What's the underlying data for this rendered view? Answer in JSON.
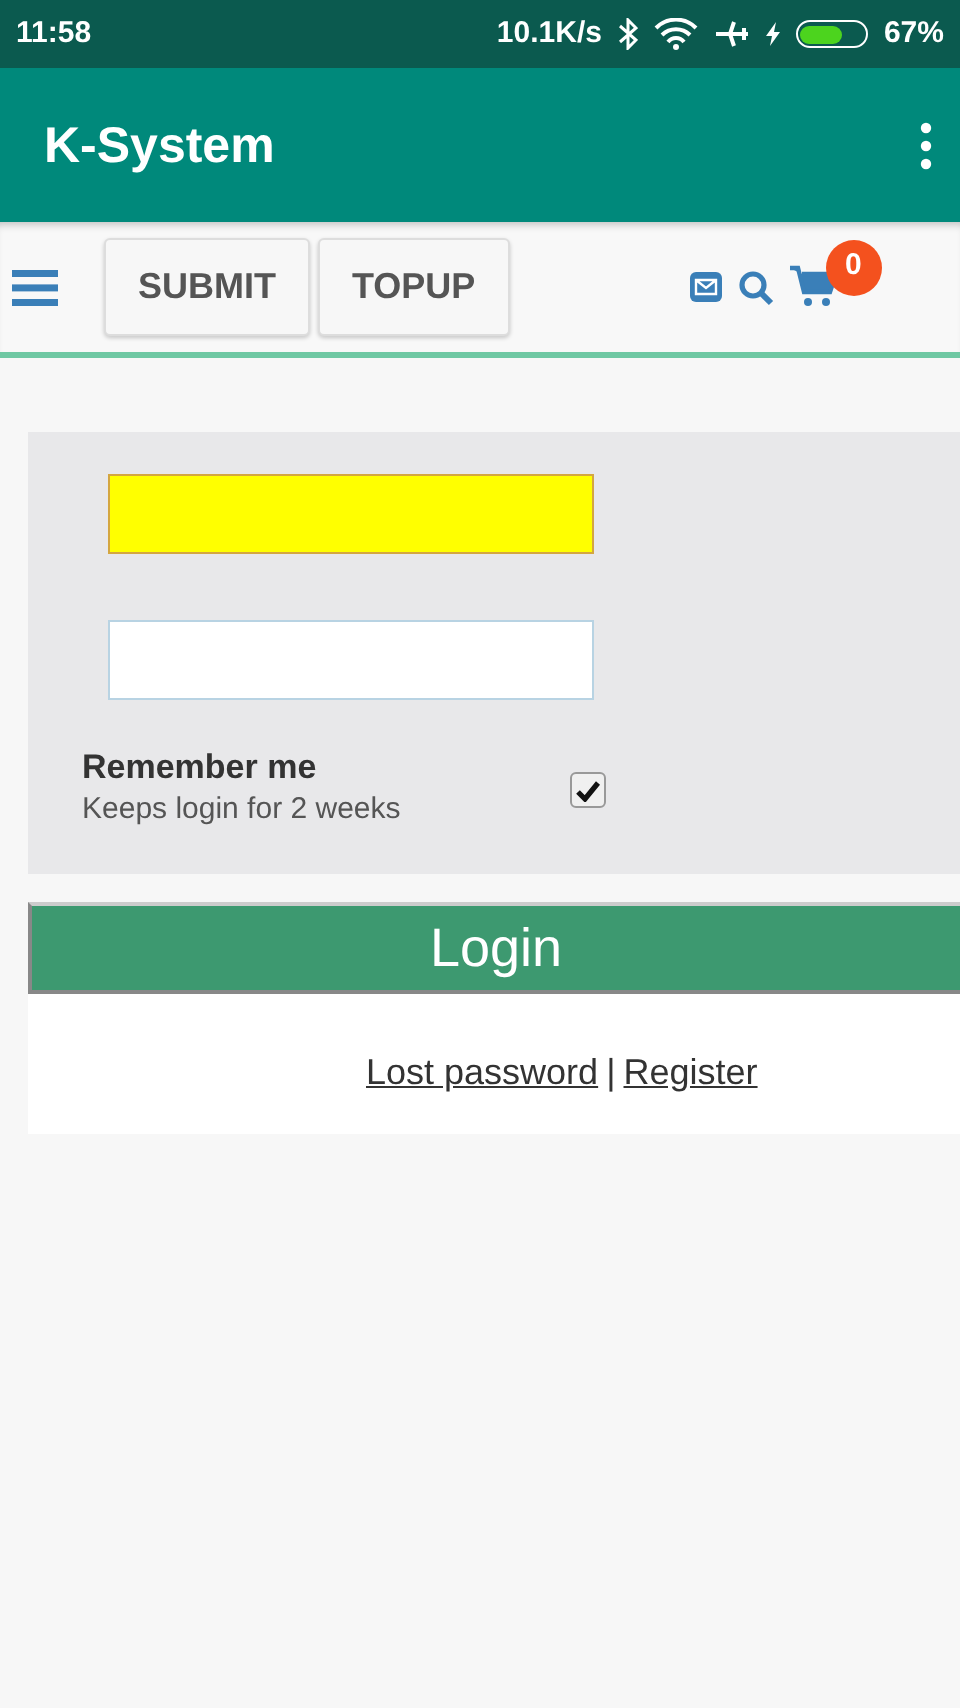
{
  "status_bar": {
    "time": "11:58",
    "speed": "10.1K/s",
    "battery_text": "67%"
  },
  "app_bar": {
    "title": "K-System"
  },
  "toolbar": {
    "buttons": [
      "SUBMIT",
      "TOPUP"
    ],
    "cart_count": "0"
  },
  "login": {
    "fields": [
      {
        "autofilled": true
      },
      {
        "autofilled": false
      }
    ],
    "remember": {
      "label": "Remember me",
      "hint": "Keeps login for 2 weeks",
      "checked": true
    },
    "button": "Login",
    "links": [
      "Lost password",
      "Register"
    ],
    "separator": "|"
  }
}
